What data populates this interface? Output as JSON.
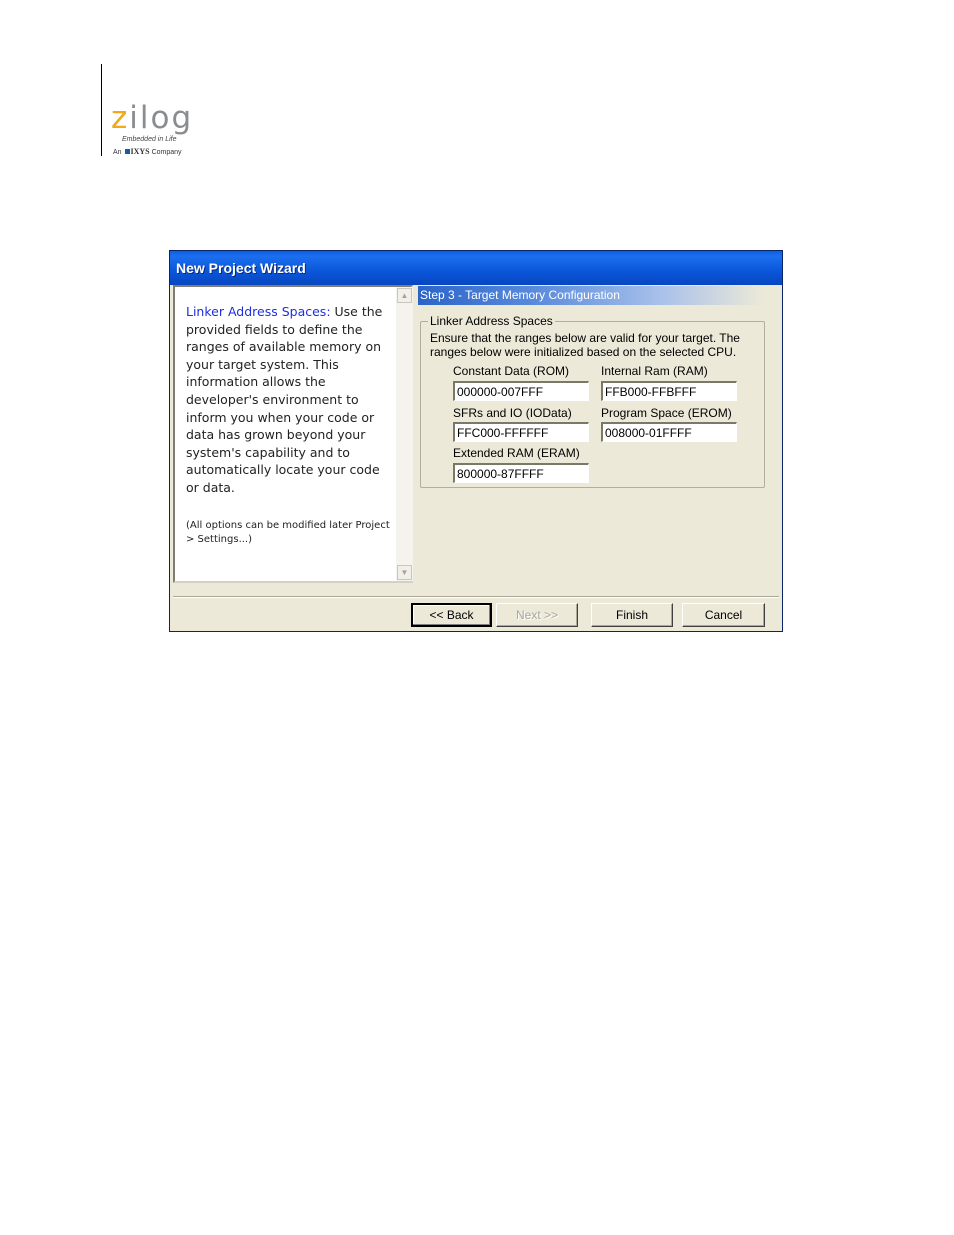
{
  "logo": {
    "brand": "zilog",
    "tagline": "Embedded in Life",
    "company_prefix": "An",
    "company_name": "IXYS",
    "company_suffix": "Company"
  },
  "dialog": {
    "title": "New Project Wizard",
    "help": {
      "lead": "Linker Address Spaces:",
      "body": " Use the provided fields to define the ranges of available memory on your target system. This information allows the developer's environment to inform you when your code or data has grown beyond your system's capability and to automatically locate your code or data.",
      "note": "(All options can be modified later Project > Settings...)"
    },
    "step_title": "Step 3 - Target Memory Configuration",
    "group": {
      "legend": "Linker Address Spaces",
      "description": "Ensure that the ranges below are valid for your target.  The ranges below were initialized based on the selected CPU.",
      "fields": {
        "constant_data": {
          "label": "Constant Data (ROM)",
          "value": "000000-007FFF"
        },
        "internal_ram": {
          "label": "Internal Ram (RAM)",
          "value": "FFB000-FFBFFF"
        },
        "sfrs_io": {
          "label": "SFRs and IO (IOData)",
          "value": "FFC000-FFFFFF"
        },
        "program_space": {
          "label": "Program Space (EROM)",
          "value": "008000-01FFFF"
        },
        "extended_ram": {
          "label": "Extended RAM (ERAM)",
          "value": "800000-87FFFF"
        }
      }
    },
    "buttons": {
      "back": "<< Back",
      "next": "Next >>",
      "finish": "Finish",
      "cancel": "Cancel"
    },
    "scroll_icons": {
      "up": "chevron-up-icon",
      "down": "chevron-down-icon"
    }
  },
  "colors": {
    "titlebar": "#0a56d9",
    "dialog_face": "#ece9d8",
    "help_lead": "#1e2ee0",
    "logo_accent": "#f2a81d",
    "logo_gray": "#8a8d8f"
  }
}
